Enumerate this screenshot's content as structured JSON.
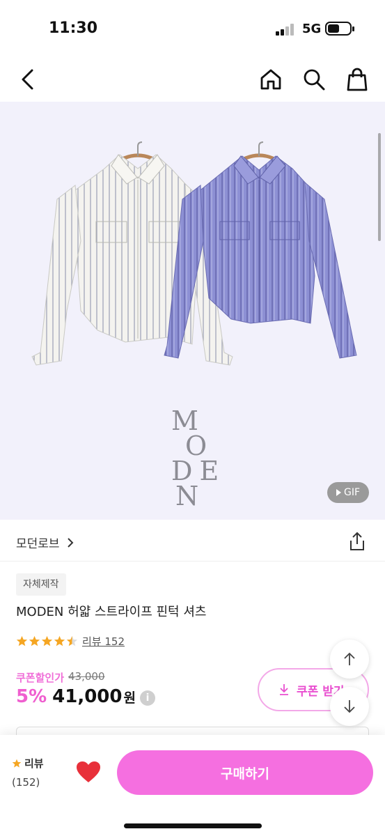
{
  "status_bar": {
    "time": "11:30",
    "network": "5G"
  },
  "hero": {
    "gif_label": "GIF",
    "watermark_text": "MODEN"
  },
  "brand": {
    "name": "모던로브"
  },
  "product": {
    "tag": "자체제작",
    "title": "MODEN 허얇 스트라이프 핀턱 셔츠",
    "rating_stars": 4.5,
    "review_label": "리뷰 152"
  },
  "price": {
    "label": "쿠폰할인가",
    "original": "43,000",
    "discount": "5%",
    "amount": "41,000",
    "currency": "원",
    "info_icon": "i"
  },
  "coupon": {
    "label": "쿠폰 받기"
  },
  "bottom_bar": {
    "review_label": "리뷰",
    "review_count": "(152)",
    "buy_label": "구매하기"
  },
  "colors": {
    "accent_pink": "#f56fe0",
    "star": "#f5a623",
    "heart": "#e8303a"
  }
}
